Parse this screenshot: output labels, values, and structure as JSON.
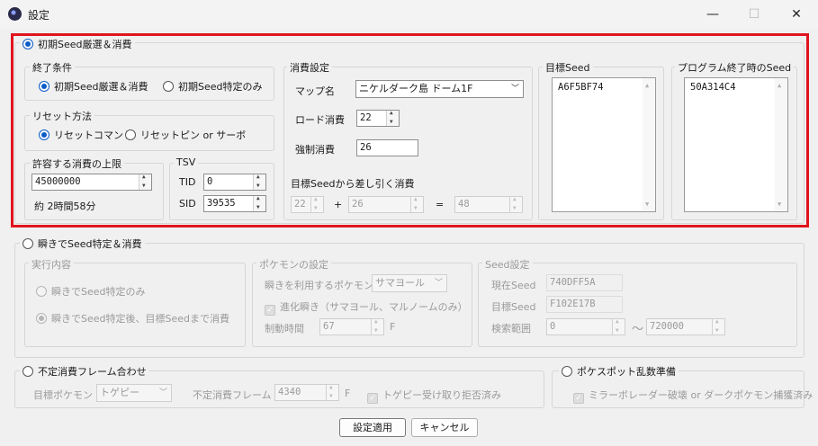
{
  "window": {
    "title": "設定",
    "minimize": "—",
    "maximize": "☐",
    "close": "✕"
  },
  "sec1": {
    "title": "初期Seed厳選＆消費",
    "end_condition": {
      "title": "終了条件",
      "opt1": "初期Seed厳選＆消費",
      "opt2": "初期Seed特定のみ"
    },
    "reset": {
      "title": "リセット方法",
      "opt1": "リセットコマンド",
      "opt2": "リセットピン or サーボ"
    },
    "limit": {
      "title": "許容する消費の上限",
      "value": "45000000",
      "approx": "約 2時間58分"
    },
    "tsv": {
      "title": "TSV",
      "tid_label": "TID",
      "tid": "0",
      "sid_label": "SID",
      "sid": "39535"
    },
    "consume": {
      "title": "消費設定",
      "map_label": "マップ名",
      "map_value": "ニケルダーク島 ドーム1F",
      "load_label": "ロード消費",
      "load_value": "22",
      "force_label": "強制消費",
      "force_value": "26",
      "sub_label": "目標Seedから差し引く消費",
      "a": "22",
      "plus": "+",
      "b": "26",
      "eq": "=",
      "c": "48"
    },
    "target_seed": {
      "title": "目標Seed",
      "value": "A6F5BF74"
    },
    "end_seed": {
      "title": "プログラム終了時のSeed",
      "value": "50A314C4"
    }
  },
  "sec2": {
    "title": "瞬きでSeed特定＆消費",
    "exec": {
      "title": "実行内容",
      "opt1": "瞬きでSeed特定のみ",
      "opt2": "瞬きでSeed特定後、目標Seedまで消費"
    },
    "poke": {
      "title": "ポケモンの設定",
      "use_label": "瞬きを利用するポケモン",
      "use_value": "サマヨール",
      "evo_label": "進化瞬き（サマヨール、マルノームのみ）",
      "time_label": "制動時間",
      "time_value": "67",
      "unit": "F"
    },
    "seed": {
      "title": "Seed設定",
      "cur_label": "現在Seed",
      "cur_value": "740DFF5A",
      "target_label": "目標Seed",
      "target_value": "F102E17B",
      "range_label": "検索範囲",
      "range_from": "0",
      "tilde": "～",
      "range_to": "720000"
    }
  },
  "sec3": {
    "title": "不定消費フレーム合わせ",
    "target_label": "目標ポケモン",
    "target_value": "トゲピー",
    "frame_label": "不定消費フレーム",
    "frame_value": "4340",
    "unit": "F",
    "check_label": "トゲピー受け取り拒否済み"
  },
  "sec4": {
    "title": "ポケスポット乱数準備",
    "check_label": "ミラーボレーダー破壊 or ダークポケモン捕獲済み"
  },
  "buttons": {
    "apply": "設定適用",
    "cancel": "キャンセル"
  }
}
